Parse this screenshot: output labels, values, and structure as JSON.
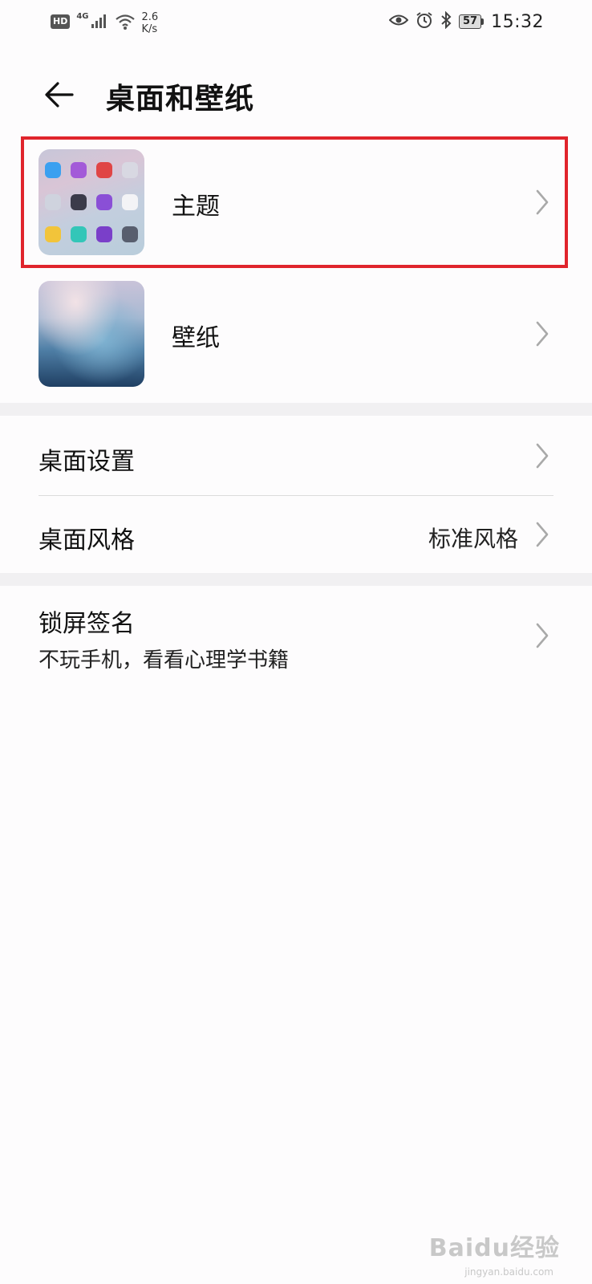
{
  "status_bar": {
    "hd": "HD",
    "network": "4G",
    "speed_value": "2.6",
    "speed_unit": "K/s",
    "battery": "57",
    "time": "15:32"
  },
  "header": {
    "title": "桌面和壁纸"
  },
  "items": {
    "theme": {
      "label": "主题"
    },
    "wallpaper": {
      "label": "壁纸"
    },
    "desktop_settings": {
      "label": "桌面设置"
    },
    "desktop_style": {
      "label": "桌面风格",
      "value": "标准风格"
    },
    "lock_signature": {
      "label": "锁屏签名",
      "value": "不玩手机，看看心理学书籍"
    }
  },
  "watermark": {
    "text": "Baidu经验",
    "url_text": "jingyan.baidu.com"
  },
  "colors": {
    "highlight": "#e0242c",
    "section_gap": "#f1f0f2",
    "background": "#fdfcfd"
  }
}
